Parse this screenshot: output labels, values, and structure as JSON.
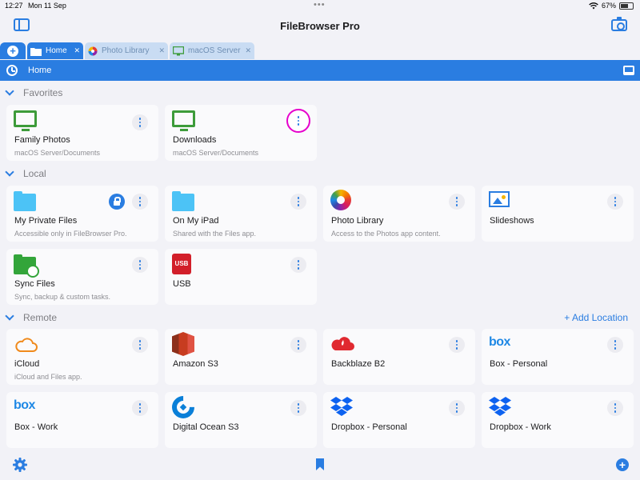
{
  "status": {
    "time": "12:27",
    "date": "Mon 11 Sep",
    "battery": "67%",
    "battery_level": 0.67,
    "dots": "•••"
  },
  "app": {
    "title": "FileBrowser Pro"
  },
  "tabs": [
    {
      "label": "Home",
      "active": true,
      "icon": "folder-icon"
    },
    {
      "label": "Photo Library",
      "active": false,
      "icon": "photos-icon"
    },
    {
      "label": "macOS Server",
      "active": false,
      "icon": "monitor-icon"
    }
  ],
  "tab_add_label": "+",
  "path": {
    "label": "Home"
  },
  "sections": {
    "favorites": "Favorites",
    "local": "Local",
    "remote": "Remote",
    "add_location": "+ Add Location"
  },
  "favorites": [
    {
      "name": "Family Photos",
      "sub": "macOS Server/Documents",
      "icon": "monitor-icon"
    },
    {
      "name": "Downloads",
      "sub": "macOS Server/Documents",
      "icon": "monitor-icon"
    }
  ],
  "local": [
    {
      "name": "My Private Files",
      "sub": "Accessible only in FileBrowser Pro.",
      "icon": "folder-icon"
    },
    {
      "name": "On My iPad",
      "sub": "Shared with the Files app.",
      "icon": "folder-icon"
    },
    {
      "name": "Photo Library",
      "sub": "Access to the Photos app content.",
      "icon": "photos-icon"
    },
    {
      "name": "Slideshows",
      "sub": "",
      "icon": "slideshow-icon"
    },
    {
      "name": "Sync Files",
      "sub": "Sync, backup & custom tasks.",
      "icon": "sync-folder-icon"
    },
    {
      "name": "USB",
      "sub": "",
      "icon": "usb-icon"
    }
  ],
  "usb_icon_text": "USB",
  "remote": [
    {
      "name": "iCloud",
      "sub": "iCloud and Files app.",
      "icon": "icloud-icon"
    },
    {
      "name": "Amazon S3",
      "sub": "",
      "icon": "amazon-s3-icon"
    },
    {
      "name": "Backblaze B2",
      "sub": "",
      "icon": "backblaze-icon"
    },
    {
      "name": "Box - Personal",
      "sub": "",
      "icon": "box-icon"
    },
    {
      "name": "Box - Work",
      "sub": "",
      "icon": "box-icon"
    },
    {
      "name": "Digital Ocean S3",
      "sub": "",
      "icon": "digitalocean-icon"
    },
    {
      "name": "Dropbox - Personal",
      "sub": "",
      "icon": "dropbox-icon"
    },
    {
      "name": "Dropbox - Work",
      "sub": "",
      "icon": "dropbox-icon"
    }
  ],
  "box_logo_text": "box",
  "bottom": {
    "add_label": "+"
  },
  "colors": {
    "accent": "#2a7de1",
    "highlight_ring": "#e600cc",
    "monitor_green": "#3d9b3a"
  }
}
